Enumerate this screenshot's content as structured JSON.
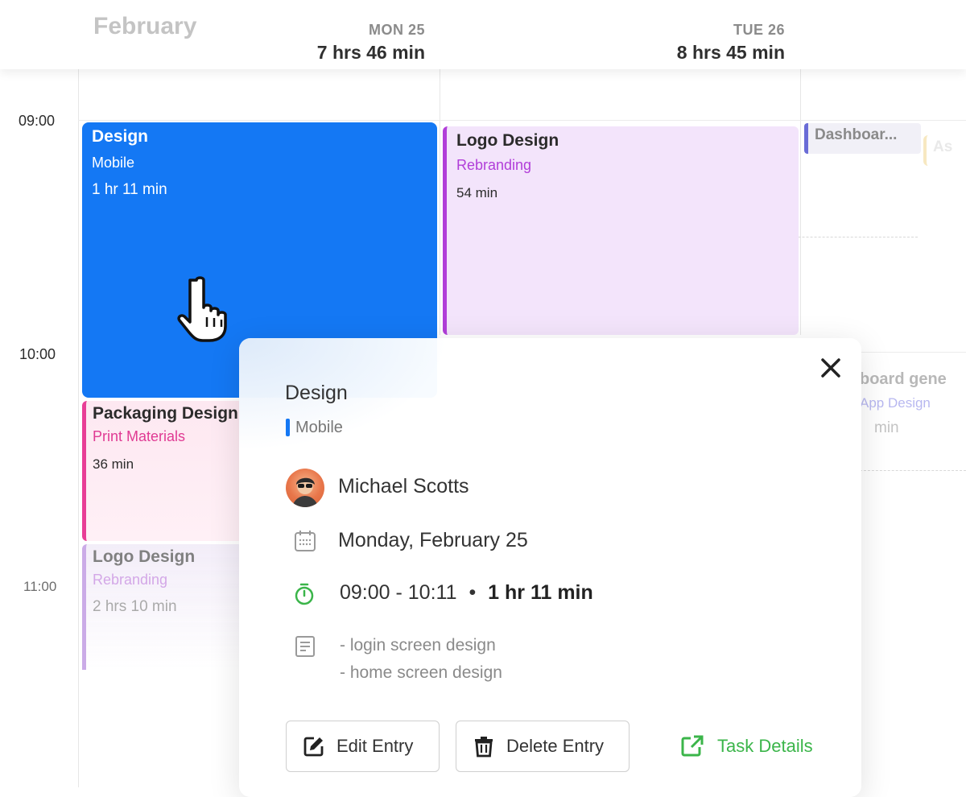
{
  "header": {
    "month": "February",
    "days": [
      {
        "name": "MON 25",
        "total": "7 hrs 46 min"
      },
      {
        "name": "TUE 26",
        "total": "8 hrs 45 min"
      }
    ]
  },
  "times": [
    "09:00",
    "10:00",
    "11:00"
  ],
  "events": {
    "design": {
      "title": "Design",
      "subtitle": "Mobile",
      "duration": "1 hr 11 min",
      "color": "#1478f4"
    },
    "logo_design_tue": {
      "title": "Logo Design",
      "subtitle": "Rebranding",
      "duration": "54 min",
      "color": "#b13ed9"
    },
    "packaging": {
      "title": "Packaging Design",
      "subtitle": "Print Materials",
      "duration": "36 min",
      "color": "#e83e96"
    },
    "logo_design_mon": {
      "title": "Logo Design",
      "subtitle": "Rebranding",
      "duration": "2 hrs 10 min",
      "color": "#c9a7e6"
    },
    "dashboard": {
      "title": "Dashboar...",
      "color": "#6a6cd6"
    },
    "as_partial": {
      "title": "As"
    },
    "right_partial": {
      "title": "board gene",
      "subtitle": "App Design",
      "duration": "min"
    }
  },
  "popover": {
    "title": "Design",
    "tag": "Mobile",
    "user": "Michael Scotts",
    "date": "Monday, February 25",
    "time_range": "09:00 - 10:11",
    "separator": "•",
    "duration": "1 hr 11 min",
    "notes": [
      "- login screen design",
      "- home screen design"
    ],
    "buttons": {
      "edit": "Edit Entry",
      "delete": "Delete Entry",
      "details": "Task Details"
    },
    "icons": [
      "close-icon",
      "calendar-icon",
      "stopwatch-icon",
      "notes-icon",
      "edit-icon",
      "trash-icon",
      "external-link-icon"
    ]
  }
}
